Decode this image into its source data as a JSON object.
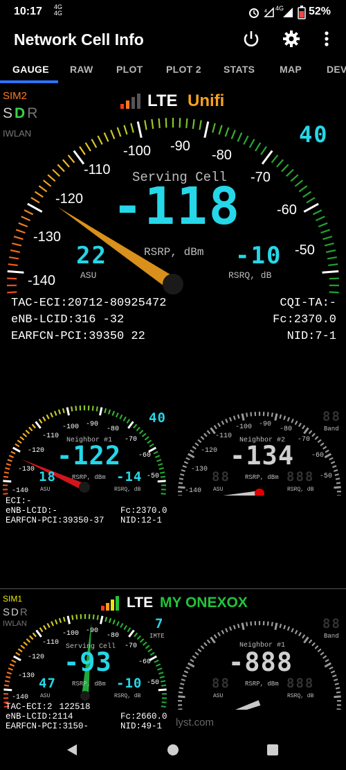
{
  "status_bar": {
    "time": "10:17",
    "network_left": "4G 4G",
    "network_right": "4G",
    "battery": "52%",
    "icons": [
      "alarm-icon",
      "signal-icon",
      "battery-icon"
    ]
  },
  "app": {
    "title": "Network Cell Info",
    "actions": [
      "power-icon",
      "settings-icon",
      "more-vert-icon"
    ]
  },
  "tabs": [
    "GAUGE",
    "RAW",
    "PLOT",
    "PLOT 2",
    "STATS",
    "MAP",
    "DEV"
  ],
  "sim2": {
    "label": "SIM2",
    "sdr": [
      "S",
      "D",
      "R"
    ],
    "iwlan": "IWLAN",
    "tech": "LTE",
    "operator": "Unifi",
    "operator_color": "#f6a21c",
    "gauge": {
      "ticks": [
        "-140",
        "-130",
        "-120",
        "-110",
        "-100",
        "-90",
        "-80",
        "-70",
        "-60",
        "-50"
      ],
      "title": "Serving Cell",
      "value": "-118",
      "unit": "RSRP, dBm",
      "asu": "22",
      "asu_label": "ASU",
      "rsrq": "-10",
      "rsrq_label": "RSRQ, dB",
      "badge": "40"
    },
    "info_left": [
      "TAC-ECI:20712-80925472",
      "eNB-LCID:316   -32",
      "EARFCN-PCI:39350   22"
    ],
    "info_right": [
      "CQI-TA:-",
      "Fc:2370.0",
      "NID:7-1"
    ]
  },
  "neighbor1": {
    "title": "Neighbor #1",
    "ticks": [
      "-140",
      "-130",
      "-120",
      "-110",
      "-100",
      "-90",
      "-80",
      "-70",
      "-60",
      "-50"
    ],
    "value": "-122",
    "unit": "RSRP, dBm",
    "asu": "18",
    "asu_label": "ASU",
    "rsrq": "-14",
    "rsrq_label": "RSRQ, dB",
    "badge": "40",
    "info_left": [
      "ECI:-",
      "eNB-LCID:-",
      "EARFCN-PCI:39350-37"
    ],
    "info_right": [
      "Fc:2370.0",
      "NID:12-1"
    ]
  },
  "neighbor2": {
    "title": "Neighbor #2",
    "ticks": [
      "-140",
      "-130",
      "-120",
      "-110",
      "-100",
      "-90",
      "-80",
      "-70",
      "-60",
      "-50"
    ],
    "value": "-134",
    "unit": "RSRP, dBm",
    "asu": "88",
    "asu_label": "ASU",
    "rsrq": "888",
    "rsrq_label": "RSRQ, dB",
    "badge": "88",
    "badge_label": "Band"
  },
  "sim1": {
    "label": "SIM1",
    "sdr": [
      "S",
      "D",
      "R"
    ],
    "iwlan": "IWLAN",
    "tech": "LTE",
    "operator": "MY ONEXOX",
    "operator_color": "#22c33b",
    "gauge": {
      "ticks": [
        "-140",
        "-130",
        "-120",
        "-110",
        "-100",
        "-90",
        "-80",
        "-70",
        "-60",
        "-50"
      ],
      "title": "Serving Cell",
      "value": "-93",
      "unit": "RSRP, dBm",
      "asu": "47",
      "asu_label": "ASU",
      "rsrq": "-10",
      "rsrq_label": "RSRQ, dB",
      "badge": "7",
      "badge_label": "IMTE"
    },
    "info_left": [
      "TAC-ECI:2    122518",
      "eNB-LCID:2114   ",
      "EARFCN-PCI:3150-   "
    ],
    "info_right": [
      "Fc:2660.0",
      "NID:49-1"
    ],
    "neighbor": {
      "title": "Neighbor #1",
      "value": "-888",
      "unit": "RSRP, dBm",
      "asu": "88",
      "asu_label": "ASU",
      "rsrq": "888",
      "rsrq_label": "RSRQ, dB",
      "badge": "88",
      "badge_label": "Band"
    }
  },
  "watermark": "lyst.com",
  "navbar": [
    "back-icon",
    "home-icon",
    "recents-icon"
  ]
}
